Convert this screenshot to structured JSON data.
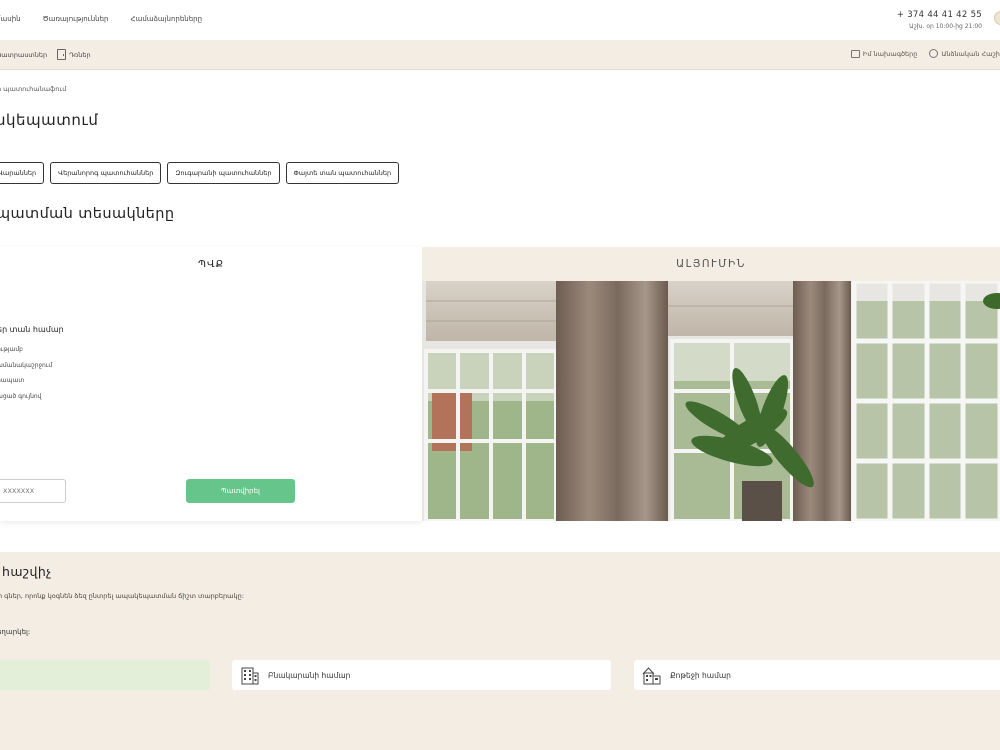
{
  "topnav": {
    "items": [
      "մասին",
      "Ծառայություններ",
      "Համաձայնորեները"
    ]
  },
  "contact": {
    "phone": "+ 374 44 41 42 55",
    "hours": "Աշխ. օր 10:00-ից 21:00"
  },
  "subnav": {
    "left": [
      "Պատրաստներ",
      "Դռներ"
    ],
    "right": [
      "Իմ նախագծերը",
      "Անձնական Հաշիվ"
    ]
  },
  "breadcrumb": "ր պատուհանաֆում",
  "page_title": "սկեպատում",
  "tabs": [
    "Վարաններ",
    "Վերանորոգ պատուհաններ",
    "Զուգարանի պատուհաններ",
    "Փայտե տան պատուհաններ"
  ],
  "types_title": "պատման տեսակները",
  "compare": {
    "left_header": "ՊՎՔ",
    "features_title": "եր տան համար",
    "features": [
      "ությամբ",
      "ամանակաշրջում",
      "րապատ",
      "ացած գույնով"
    ],
    "phone_placeholder": "XXXXXXX",
    "order_button": "Պատվիրել",
    "right_header": "ԱԼՅՈՒՄԻՆ"
  },
  "calculator": {
    "title": "հաշվիչ",
    "description": "ի գներ, որոնք կօգնեն ձեզ ընտրել ապակեպատման ճիշտ տարբերակը:",
    "choose_label": "եղարկել:",
    "options": [
      "Բնակարանի համար",
      "Քոթեջի համար"
    ]
  },
  "colors": {
    "beige": "#f3ede3",
    "green": "#66c58a",
    "light_green": "#e3efd8"
  }
}
